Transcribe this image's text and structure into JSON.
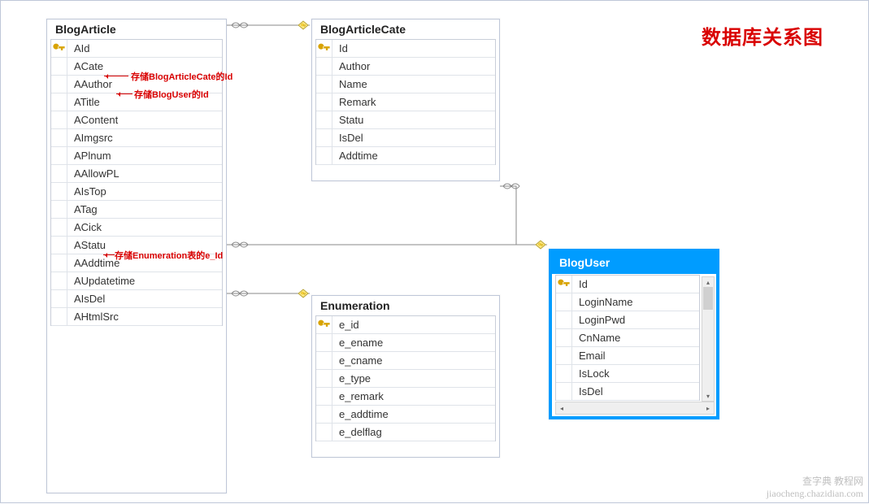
{
  "title": "数据库关系图",
  "tables": {
    "blogArticle": {
      "name": "BlogArticle",
      "columns": [
        {
          "name": "AId",
          "pk": true
        },
        {
          "name": "ACate",
          "pk": false
        },
        {
          "name": "AAuthor",
          "pk": false
        },
        {
          "name": "ATitle",
          "pk": false
        },
        {
          "name": "AContent",
          "pk": false
        },
        {
          "name": "AImgsrc",
          "pk": false
        },
        {
          "name": "APlnum",
          "pk": false
        },
        {
          "name": "AAllowPL",
          "pk": false
        },
        {
          "name": "AIsTop",
          "pk": false
        },
        {
          "name": "ATag",
          "pk": false
        },
        {
          "name": "ACick",
          "pk": false
        },
        {
          "name": "AStatu",
          "pk": false
        },
        {
          "name": "AAddtime",
          "pk": false
        },
        {
          "name": "AUpdatetime",
          "pk": false
        },
        {
          "name": "AIsDel",
          "pk": false
        },
        {
          "name": "AHtmlSrc",
          "pk": false
        }
      ]
    },
    "blogArticleCate": {
      "name": "BlogArticleCate",
      "columns": [
        {
          "name": "Id",
          "pk": true
        },
        {
          "name": "Author",
          "pk": false
        },
        {
          "name": "Name",
          "pk": false
        },
        {
          "name": "Remark",
          "pk": false
        },
        {
          "name": "Statu",
          "pk": false
        },
        {
          "name": "IsDel",
          "pk": false
        },
        {
          "name": "Addtime",
          "pk": false
        }
      ]
    },
    "enumeration": {
      "name": "Enumeration",
      "columns": [
        {
          "name": "e_id",
          "pk": true
        },
        {
          "name": "e_ename",
          "pk": false
        },
        {
          "name": "e_cname",
          "pk": false
        },
        {
          "name": "e_type",
          "pk": false
        },
        {
          "name": "e_remark",
          "pk": false
        },
        {
          "name": "e_addtime",
          "pk": false
        },
        {
          "name": "e_delflag",
          "pk": false
        }
      ]
    },
    "blogUser": {
      "name": "BlogUser",
      "columns": [
        {
          "name": "Id",
          "pk": true
        },
        {
          "name": "LoginName",
          "pk": false
        },
        {
          "name": "LoginPwd",
          "pk": false
        },
        {
          "name": "CnName",
          "pk": false
        },
        {
          "name": "Email",
          "pk": false
        },
        {
          "name": "IsLock",
          "pk": false
        },
        {
          "name": "IsDel",
          "pk": false
        }
      ]
    }
  },
  "annotations": {
    "acate": "存储BlogArticleCate的Id",
    "aauthor": "存储BlogUser的Id",
    "astatu": "存储Enumeration表的e_Id"
  },
  "relationships": [
    {
      "from": "BlogArticle",
      "to": "BlogArticleCate",
      "fromEnd": "many",
      "toEnd": "one-key"
    },
    {
      "from": "BlogArticle",
      "to": "BlogUser",
      "fromEnd": "many",
      "toEnd": "one-key"
    },
    {
      "from": "BlogArticle",
      "to": "Enumeration",
      "fromEnd": "many",
      "toEnd": "one-key"
    },
    {
      "from": "BlogArticleCate",
      "to": "BlogUser",
      "fromEnd": "many",
      "toEnd": "one-key"
    }
  ],
  "watermark": {
    "line1": "查字典 教程网",
    "line2": "jiaocheng.chazidian.com"
  }
}
